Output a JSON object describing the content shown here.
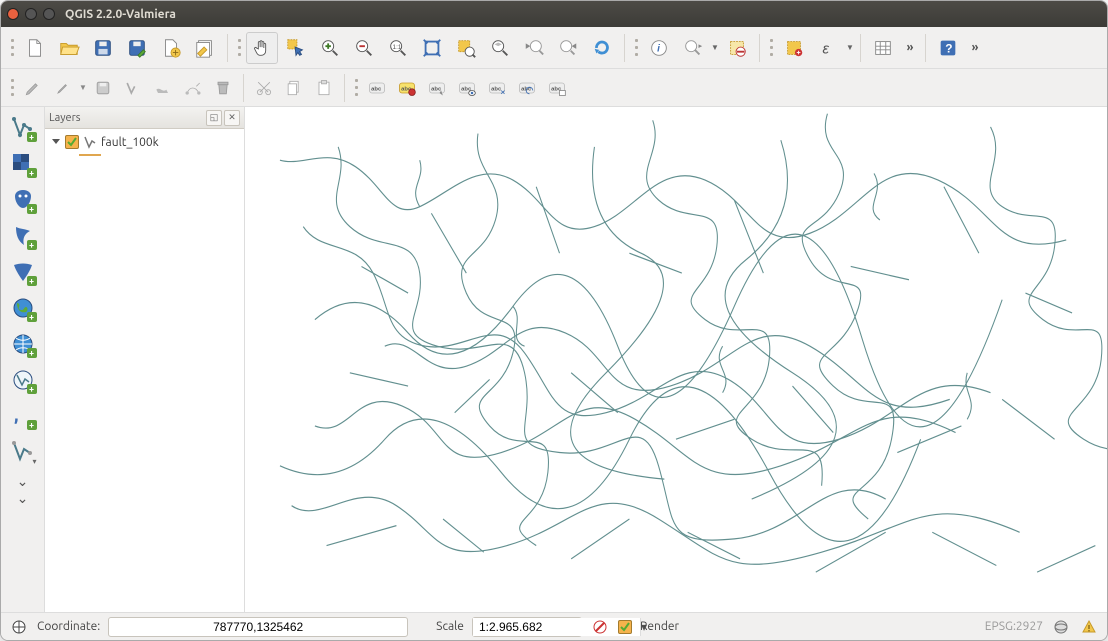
{
  "window": {
    "title": "QGIS 2.2.0-Valmiera"
  },
  "layers_panel": {
    "title": "Layers",
    "items": [
      {
        "name": "fault_100k",
        "checked": true,
        "expanded": true
      }
    ]
  },
  "statusbar": {
    "coord_label": "Coordinate:",
    "coord_value": "787770,1325462",
    "scale_label": "Scale",
    "scale_value": "1:2.965.682",
    "render_label": "Render",
    "render_checked": true,
    "crs": "EPSG:2927"
  },
  "icons": {
    "toolbar1": [
      "new-project",
      "open-project",
      "save-project",
      "save-as-project",
      "new-composer",
      "composer-manager"
    ],
    "toolbar2": [
      "pan",
      "pan-selection",
      "zoom-in",
      "zoom-out",
      "zoom-native",
      "zoom-full",
      "zoom-selection",
      "zoom-layer",
      "zoom-last",
      "zoom-next",
      "refresh"
    ],
    "toolbar3": [
      "identify",
      "select",
      "deselect",
      "measure",
      "bookmark",
      "text-annotation",
      "form-annotation"
    ],
    "toolbar4": [
      "help"
    ],
    "toolbar_edit": [
      "edit-pencil",
      "edit-node",
      "edit-save",
      "edit-remove",
      "digitize-polygon",
      "digitize-cut",
      "digitize-scissor",
      "copy-features",
      "paste-features"
    ],
    "toolbar_label": [
      "label-abc",
      "label-highlight",
      "label-pin",
      "label-show",
      "label-move",
      "label-rotate",
      "label-change"
    ],
    "leftbar": [
      "add-vector",
      "add-raster",
      "add-postgis",
      "add-spatialite",
      "add-wms",
      "add-wcs",
      "add-wfs",
      "add-csv",
      "add-virtual"
    ]
  },
  "colors": {
    "fault_stroke": "#5a8a8a"
  }
}
